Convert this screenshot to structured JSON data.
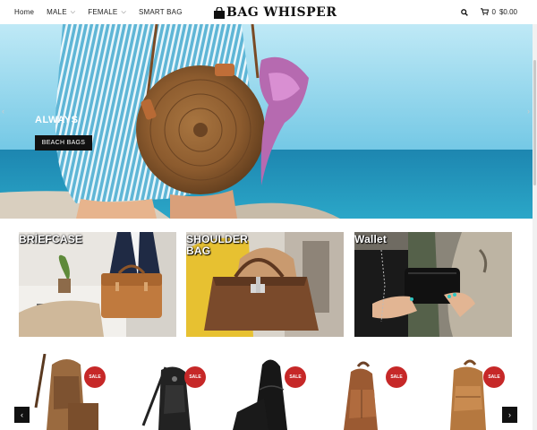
{
  "header": {
    "logo_text": "BAG WHISPER",
    "nav": [
      {
        "label": "Home"
      },
      {
        "label": "MALE"
      },
      {
        "label": "FEMALE"
      },
      {
        "label": "SMART BAG"
      }
    ],
    "cart_count": "0",
    "cart_total": "$0.00"
  },
  "hero": {
    "caption": "ALWAYS",
    "button_label": "BEACH BAGS"
  },
  "categories": [
    {
      "label": "BRİEFCASE"
    },
    {
      "label": "SHOULDER BAG"
    },
    {
      "label": "Wallet"
    }
  ],
  "products": [
    {
      "badge": "SALE"
    },
    {
      "badge": "SALE"
    },
    {
      "badge": "SALE"
    },
    {
      "badge": "SALE"
    },
    {
      "badge": "SALE"
    }
  ],
  "colors": {
    "sale_badge": "#c62828",
    "sea": "#1e8fb5",
    "sky": "#6fc6e4",
    "dark": "#111111"
  }
}
